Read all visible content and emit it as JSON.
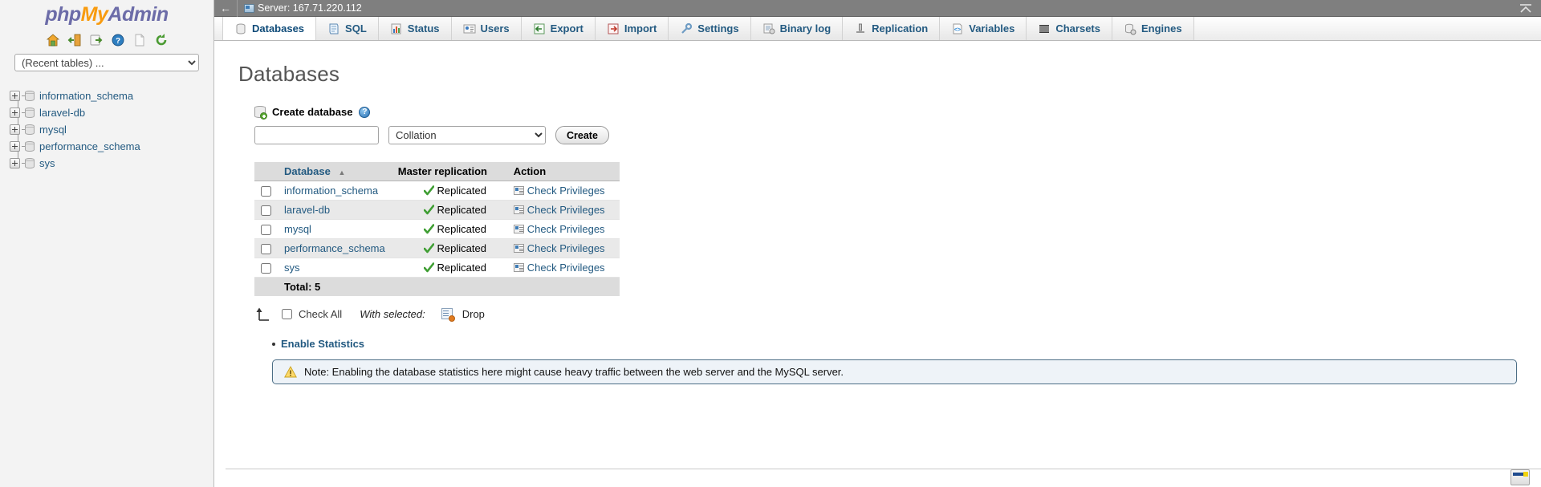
{
  "sidebar": {
    "logo": {
      "php": "php",
      "my": "My",
      "admin": "Admin"
    },
    "nav_icons": [
      {
        "name": "home-icon",
        "title": "Home"
      },
      {
        "name": "logout-icon",
        "title": "Log out"
      },
      {
        "name": "docs-icon",
        "title": "phpMyAdmin documentation"
      },
      {
        "name": "help-icon",
        "title": "Documentation"
      },
      {
        "name": "copy-icon",
        "title": "Copy"
      },
      {
        "name": "reload-icon",
        "title": "Reload navigation panel"
      }
    ],
    "recent_select": {
      "value": "(Recent tables) ...",
      "options": [
        "(Recent tables) ..."
      ]
    },
    "tree": [
      {
        "label": "information_schema"
      },
      {
        "label": "laravel-db"
      },
      {
        "label": "mysql"
      },
      {
        "label": "performance_schema"
      },
      {
        "label": "sys"
      }
    ]
  },
  "serverbar": {
    "back": "←",
    "label": "Server: 167.71.220.112",
    "collapse_title": "Collapse"
  },
  "tabs": [
    {
      "label": "Databases",
      "icon": "database-icon",
      "active": true
    },
    {
      "label": "SQL",
      "icon": "sql-icon",
      "active": false
    },
    {
      "label": "Status",
      "icon": "status-icon",
      "active": false
    },
    {
      "label": "Users",
      "icon": "users-icon",
      "active": false
    },
    {
      "label": "Export",
      "icon": "export-icon",
      "active": false
    },
    {
      "label": "Import",
      "icon": "import-icon",
      "active": false
    },
    {
      "label": "Settings",
      "icon": "settings-icon",
      "active": false
    },
    {
      "label": "Binary log",
      "icon": "binary-log-icon",
      "active": false
    },
    {
      "label": "Replication",
      "icon": "replication-icon",
      "active": false
    },
    {
      "label": "Variables",
      "icon": "variables-icon",
      "active": false
    },
    {
      "label": "Charsets",
      "icon": "charsets-icon",
      "active": false
    },
    {
      "label": "Engines",
      "icon": "engines-icon",
      "active": false
    }
  ],
  "page": {
    "title": "Databases",
    "create": {
      "heading": "Create database",
      "dbname_value": "",
      "dbname_placeholder": "",
      "collation_value": "Collation",
      "collation_options": [
        "Collation"
      ],
      "create_button": "Create"
    },
    "table": {
      "headers": {
        "checkbox": "",
        "database": "Database",
        "sort_indicator": "▲",
        "master_replication": "Master replication",
        "action": "Action"
      },
      "rows": [
        {
          "name": "information_schema",
          "replication": "Replicated",
          "action": "Check Privileges",
          "checked": false
        },
        {
          "name": "laravel-db",
          "replication": "Replicated",
          "action": "Check Privileges",
          "checked": false
        },
        {
          "name": "mysql",
          "replication": "Replicated",
          "action": "Check Privileges",
          "checked": false
        },
        {
          "name": "performance_schema",
          "replication": "Replicated",
          "action": "Check Privileges",
          "checked": false
        },
        {
          "name": "sys",
          "replication": "Replicated",
          "action": "Check Privileges",
          "checked": false
        }
      ],
      "total": "Total: 5"
    },
    "bulk": {
      "check_all": "Check All",
      "with_selected": "With selected:",
      "drop": "Drop"
    },
    "enable_statistics": "Enable Statistics",
    "note": "Note: Enabling the database statistics here might cause heavy traffic between the web server and the MySQL server."
  },
  "colors": {
    "link": "#235a81",
    "accent_orange": "#f89b0f",
    "logo_purple": "#6c6ca8",
    "success_green": "#58a832",
    "serverbar_gray": "#7f7f7f",
    "table_header_gray": "#dcdcdc",
    "note_bg": "#eef3f8",
    "note_border": "#4c6e86"
  }
}
